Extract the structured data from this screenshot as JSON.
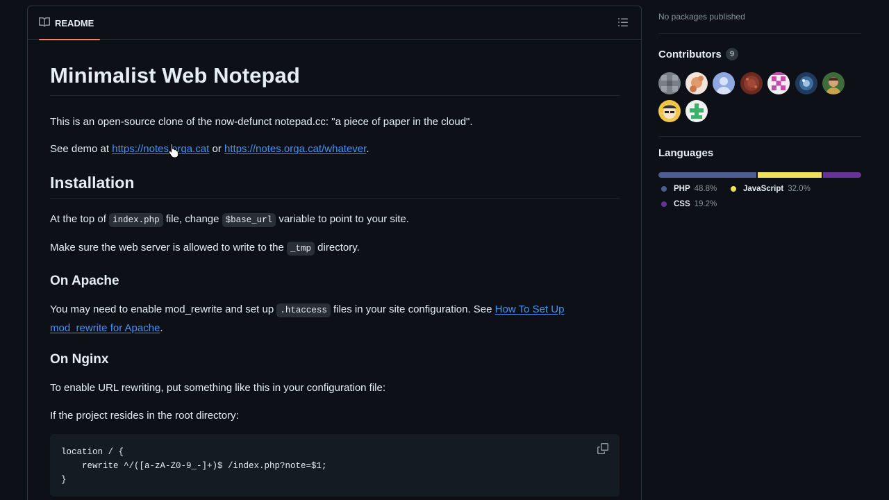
{
  "readme": {
    "tab_label": "README",
    "title": "Minimalist Web Notepad",
    "intro": "This is an open-source clone of the now-defunct notepad.cc: \"a piece of paper in the cloud\".",
    "demo_prefix": "See demo at ",
    "demo_link1": "https://notes.orga.cat",
    "demo_or": " or ",
    "demo_link2": "https://notes.orga.cat/whatever",
    "demo_suffix": ".",
    "installation_heading": "Installation",
    "install_p1_a": "At the top of ",
    "install_p1_code1": "index.php",
    "install_p1_b": " file, change ",
    "install_p1_code2": "$base_url",
    "install_p1_c": " variable to point to your site.",
    "install_p2_a": "Make sure the web server is allowed to write to the ",
    "install_p2_code": "_tmp",
    "install_p2_b": " directory.",
    "apache_heading": "On Apache",
    "apache_p_a": "You may need to enable mod_rewrite and set up ",
    "apache_p_code": ".htaccess",
    "apache_p_b": " files in your site configuration. See ",
    "apache_link": "How To Set Up mod_rewrite for Apache",
    "apache_p_c": ".",
    "nginx_heading": "On Nginx",
    "nginx_p1": "To enable URL rewriting, put something like this in your configuration file:",
    "nginx_p2": "If the project resides in the root directory:",
    "code_lines": [
      "location / {",
      "    rewrite ^/([a-zA-Z0-9_-]+)$ /index.php?note=$1;",
      "}"
    ]
  },
  "sidebar": {
    "packages_text": "No packages published",
    "contributors_heading": "Contributors",
    "contributors_count": "9",
    "languages_heading": "Languages",
    "languages": [
      {
        "name": "PHP",
        "percent": "48.8%",
        "value": 48.8,
        "color": "#4f5d95"
      },
      {
        "name": "JavaScript",
        "percent": "32.0%",
        "value": 32.0,
        "color": "#f1e05a"
      },
      {
        "name": "CSS",
        "percent": "19.2%",
        "value": 19.2,
        "color": "#663399"
      }
    ]
  },
  "icons": {
    "readme": "book-icon",
    "outline": "list-unordered-icon",
    "copy": "copy-icon",
    "cursor": "pointer-cursor-icon"
  },
  "colors": {
    "background": "#0d1117",
    "border": "#30363d",
    "link": "#4493f8",
    "tab_underline": "#f78166"
  }
}
